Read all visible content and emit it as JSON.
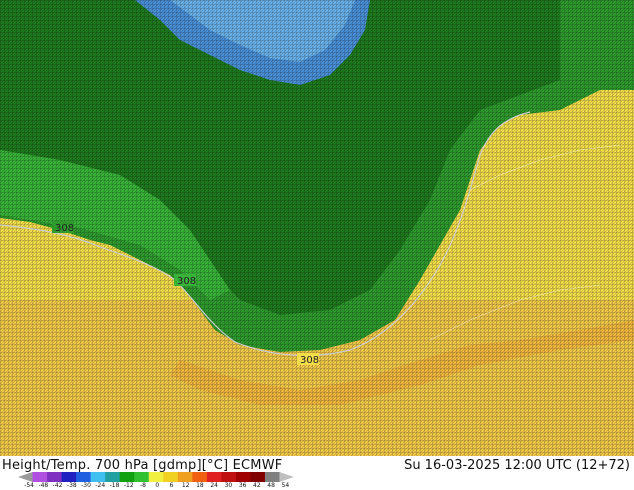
{
  "map": {
    "contour_labels": [
      {
        "text": "308"
      },
      {
        "text": "308"
      },
      {
        "text": "308"
      }
    ],
    "colors": {
      "blue_core": "#4a8fd6",
      "blue_light": "#6ab0e8",
      "green_dark": "#1f7a1f",
      "green_mid": "#2e9a2e",
      "green_light": "#39b239",
      "yellow": "#f2dd4a",
      "orange": "#f0b840"
    }
  },
  "footer": {
    "title": "Height/Temp. 700 hPa [gdmp][°C] ECMWF",
    "valid_time": "Su 16-03-2025 12:00 UTC (12+72)"
  },
  "colorbar": {
    "tick_labels": [
      "-54",
      "-48",
      "-42",
      "-38",
      "-30",
      "-24",
      "-18",
      "-12",
      "-8",
      "0",
      "6",
      "12",
      "18",
      "24",
      "30",
      "36",
      "42",
      "48",
      "54"
    ],
    "colors": [
      "#9a9a9a",
      "#b050e0",
      "#8030c0",
      "#2020c0",
      "#2060e0",
      "#40c0f0",
      "#20a0a0",
      "#10a010",
      "#30c030",
      "#f0f040",
      "#f0d020",
      "#f0a020",
      "#f06010",
      "#e02020",
      "#c01010",
      "#a00000",
      "#800000",
      "#808080",
      "#c0c0c0"
    ]
  }
}
